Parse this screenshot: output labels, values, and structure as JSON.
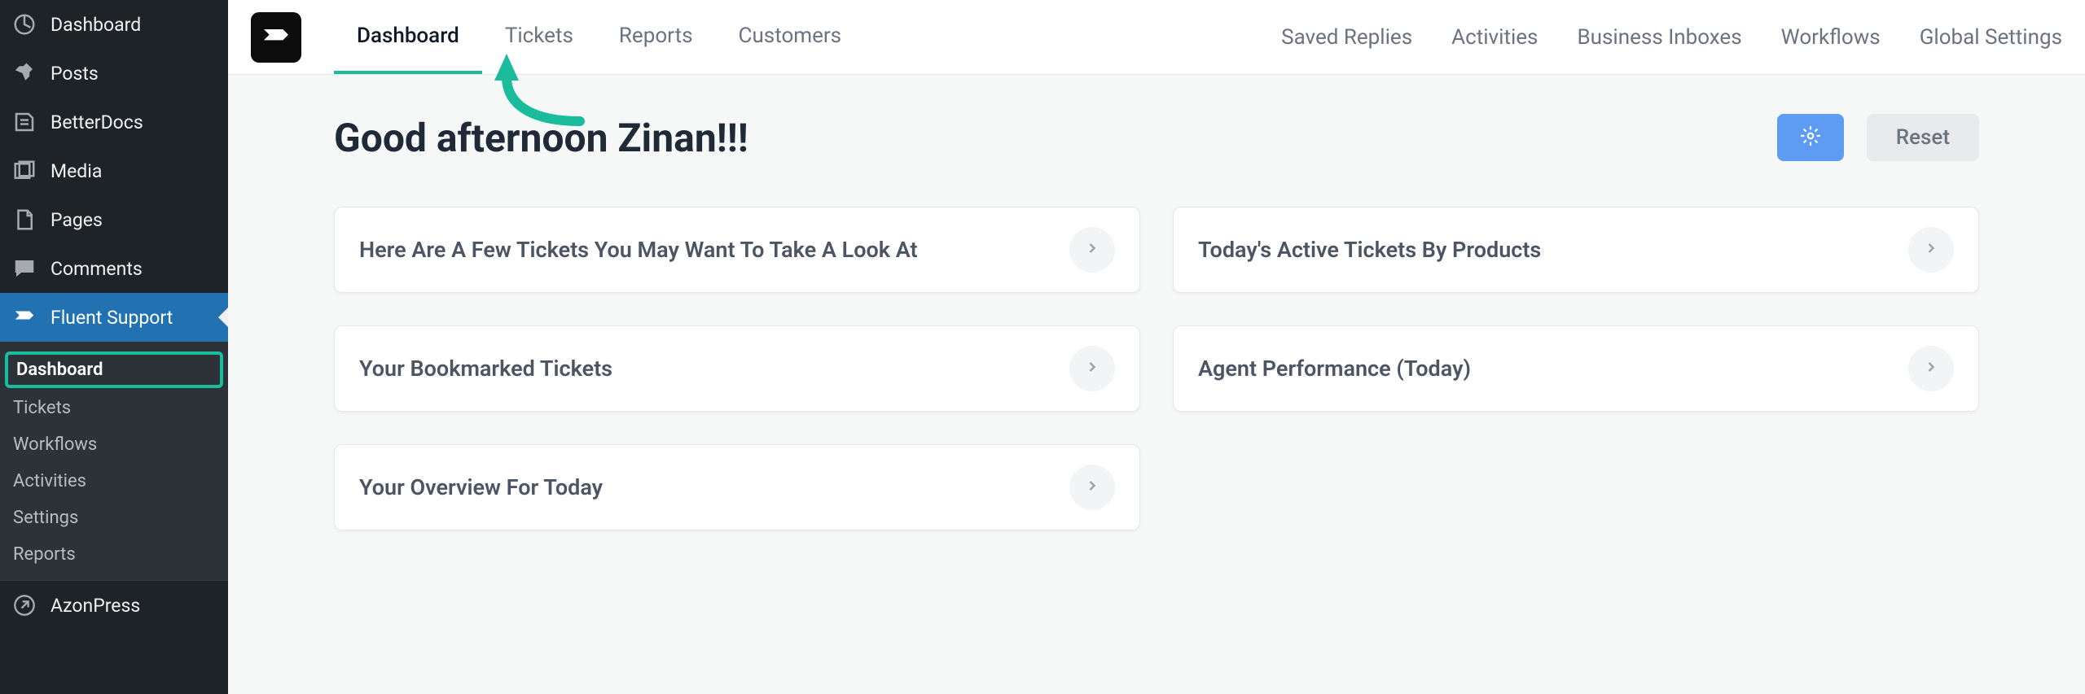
{
  "wp_sidebar": {
    "items": [
      {
        "label": "Dashboard"
      },
      {
        "label": "Posts"
      },
      {
        "label": "BetterDocs"
      },
      {
        "label": "Media"
      },
      {
        "label": "Pages"
      },
      {
        "label": "Comments"
      },
      {
        "label": "Fluent Support"
      },
      {
        "label": "AzonPress"
      }
    ],
    "submenu": [
      {
        "label": "Dashboard"
      },
      {
        "label": "Tickets"
      },
      {
        "label": "Workflows"
      },
      {
        "label": "Activities"
      },
      {
        "label": "Settings"
      },
      {
        "label": "Reports"
      }
    ]
  },
  "topbar": {
    "tabs": [
      {
        "label": "Dashboard"
      },
      {
        "label": "Tickets"
      },
      {
        "label": "Reports"
      },
      {
        "label": "Customers"
      }
    ],
    "right": [
      {
        "label": "Saved Replies"
      },
      {
        "label": "Activities"
      },
      {
        "label": "Business Inboxes"
      },
      {
        "label": "Workflows"
      },
      {
        "label": "Global Settings"
      }
    ]
  },
  "content": {
    "greeting": "Good afternoon Zinan!!!",
    "reset_label": "Reset",
    "cards": [
      {
        "title": "Here Are A Few Tickets You May Want To Take A Look At"
      },
      {
        "title": "Today's Active Tickets By Products"
      },
      {
        "title": "Your Bookmarked Tickets"
      },
      {
        "title": "Agent Performance (Today)"
      },
      {
        "title": "Your Overview For Today"
      }
    ]
  }
}
